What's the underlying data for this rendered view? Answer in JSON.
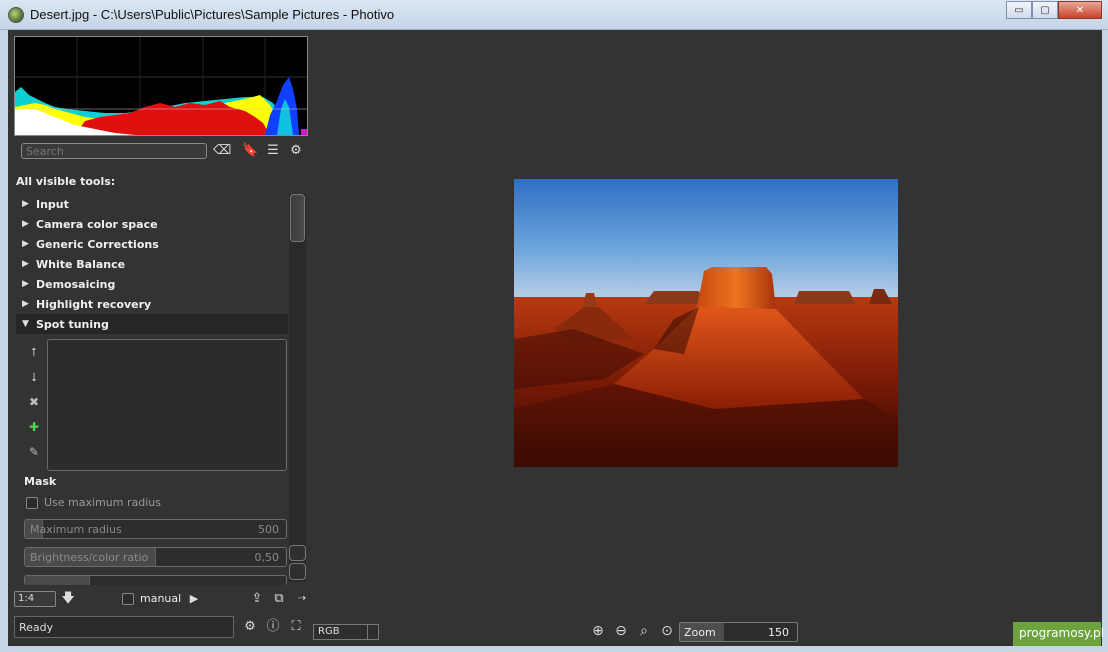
{
  "window": {
    "title": "Desert.jpg - C:\\Users\\Public\\Pictures\\Sample Pictures - Photivo",
    "minimize_label": "▭",
    "maximize_label": "▢",
    "close_label": "✕"
  },
  "toolbar": {
    "search_placeholder": "Search",
    "clear_icon": "backspace-icon",
    "bookmark_icon": "bookmark-icon",
    "menu_icon": "list-icon",
    "settings_icon": "gear-icon"
  },
  "tools": {
    "heading": "All visible tools:",
    "items": [
      {
        "label": "Input",
        "expanded": false
      },
      {
        "label": "Camera color space",
        "expanded": false
      },
      {
        "label": "Generic Corrections",
        "expanded": false
      },
      {
        "label": "White Balance",
        "expanded": false
      },
      {
        "label": "Demosaicing",
        "expanded": false
      },
      {
        "label": "Highlight recovery",
        "expanded": false
      },
      {
        "label": "Spot tuning",
        "expanded": true
      }
    ]
  },
  "spot_tuning": {
    "side_icons": [
      "arrow-up-icon",
      "arrow-down-icon",
      "delete-icon",
      "add-icon",
      "eyedropper-icon"
    ],
    "mask_label": "Mask",
    "use_max_radius_label": "Use maximum radius",
    "max_radius": {
      "label": "Maximum radius",
      "value": "500",
      "fill": 0.07
    },
    "brightness_ratio": {
      "label": "Brightness/color ratio",
      "value": "0,50",
      "fill": 0.5
    }
  },
  "bottom_bar": {
    "zoom_ratio": "1:4",
    "manual_label": "manual"
  },
  "status": {
    "text": "Ready"
  },
  "view": {
    "color_mode": "RGB",
    "zoom_label": "Zoom",
    "zoom_value": "150"
  },
  "watermark": {
    "text": "programosy.pl"
  }
}
